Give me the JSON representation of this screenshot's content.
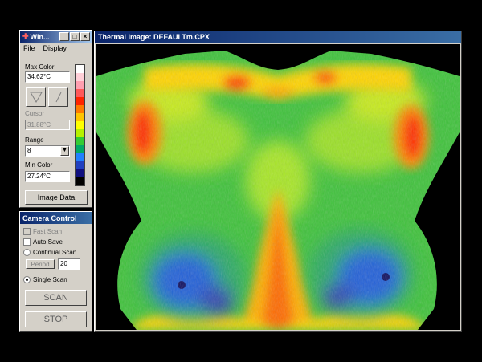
{
  "palette_window": {
    "title": "Win...",
    "menu": [
      "File",
      "Display"
    ],
    "max_color_label": "Max Color",
    "max_color_value": "34.62°C",
    "cursor_label": "Cursor",
    "cursor_value": "31.88°C",
    "range_label": "Range",
    "range_value": "8",
    "min_color_label": "Min Color",
    "min_color_value": "27.24°C",
    "image_data_button": "Image Data",
    "scale_colors": [
      "#ffffff",
      "#ffd0d8",
      "#ff9fb0",
      "#ff5a5a",
      "#ff2400",
      "#ff7a00",
      "#ffc400",
      "#ffff00",
      "#b6f000",
      "#33cc33",
      "#00aa66",
      "#2080ff",
      "#2040c0",
      "#101080",
      "#000000"
    ]
  },
  "camera_window": {
    "title": "Camera Control",
    "fast_scan": "Fast Scan",
    "auto_save": "Auto Save",
    "continual_scan": "Continual Scan",
    "period_label": "Period",
    "period_value": "20",
    "single_scan": "Single Scan",
    "scan_button": "SCAN",
    "stop_button": "STOP"
  },
  "thermal_window": {
    "title": "Thermal Image: DEFAULTm.CPX"
  }
}
